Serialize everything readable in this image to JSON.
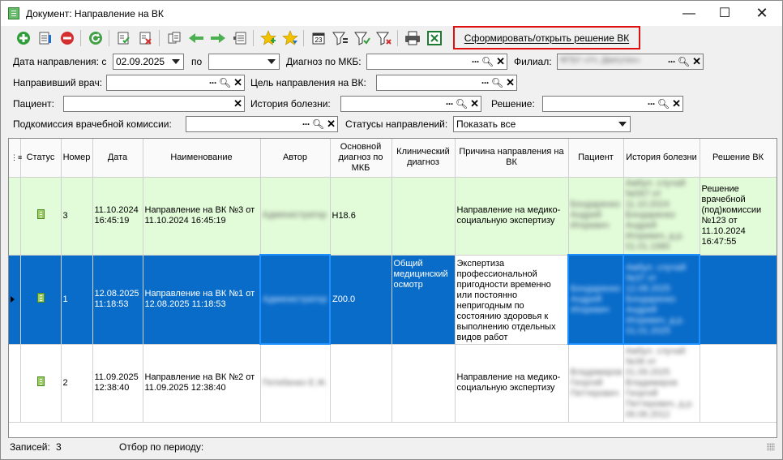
{
  "window": {
    "title": "Документ: Направление на ВК"
  },
  "toolbar": {
    "form_button_label": "Сформировать/открыть решение ВК"
  },
  "filters": {
    "date_from_label": "Дата направления: с",
    "date_from_value": "02.09.2025",
    "date_to_label": "по",
    "date_to_value": "",
    "mkb_label": "Диагноз по МКБ:",
    "branch_label": "Филиал:",
    "branch_value": "ФГБУ «Уч. Двигутин»",
    "doctor_label": "Направивший врач:",
    "purpose_label": "Цель направления на ВК:",
    "patient_label": "Пациент:",
    "history_label": "История болезни:",
    "decision_label": "Решение:",
    "subcommission_label": "Подкомиссия врачебной комиссии:",
    "statuses_label": "Статусы направлений:",
    "statuses_value": "Показать все"
  },
  "table": {
    "headers": [
      "Статус",
      "Номер",
      "Дата",
      "Наименование",
      "Автор",
      "Основной диагноз по МКБ",
      "Клинический диагноз",
      "Причина направления на ВК",
      "Пациент",
      "История болезни",
      "Решение ВК"
    ],
    "rows": [
      {
        "number": "3",
        "date": "11.10.2024 16:45:19",
        "name": "Направление на ВК №3 от 11.10.2024 16:45:19",
        "author": "Администратор",
        "mkb": "H18.6",
        "clinical": "",
        "reason": "Направление на медико-социальную экспертизу",
        "patient": "Бондаренко Андрей Игоревич",
        "history": "Амбул. случай №567 от 11.10.2024 Бондаренко Андрей Игоревич, д.р. 01.01.1980",
        "decision": "Решение врачебной (под)комиссии №123 от 11.10.2024 16:47:55"
      },
      {
        "number": "1",
        "date": "12.08.2025 11:18:53",
        "name": "Направление на ВК №1 от 12.08.2025 11:18:53",
        "author": "Администратор",
        "mkb": "Z00.0",
        "clinical": "Общий медицинский осмотр",
        "reason": "Экспертиза профессиональной пригодности временно или постоянно непригодным по состоянию здоровья к выполнению отдельных видов работ",
        "patient": "Бондаренко Андрей Игоревич",
        "history": "Амбул. случай №37 от 12.08.2025 Бондаренко Андрей Игоревич, д.р. 01.01.2025",
        "decision": ""
      },
      {
        "number": "2",
        "date": "11.09.2025 12:38:40",
        "name": "Направление на ВК №2 от 11.09.2025 12:38:40",
        "author": "Потебенко Е.Ж.",
        "mkb": "",
        "clinical": "",
        "reason": "Направление на медико-социальную экспертизу",
        "patient": "Владимиров Георгий Петтерович",
        "history": "Амбул. случай №36 от 01.09.2025 Владимиров Георгий Петтерович, д.р. 06.06.2012",
        "decision": ""
      }
    ]
  },
  "statusbar": {
    "records_label": "Записей:",
    "records_count": "3",
    "period_label": "Отбор по периоду:"
  },
  "colors": {
    "row_green": "#e2fbd8",
    "row_selected": "#0a6cc9",
    "highlight_border": "#e01010"
  }
}
